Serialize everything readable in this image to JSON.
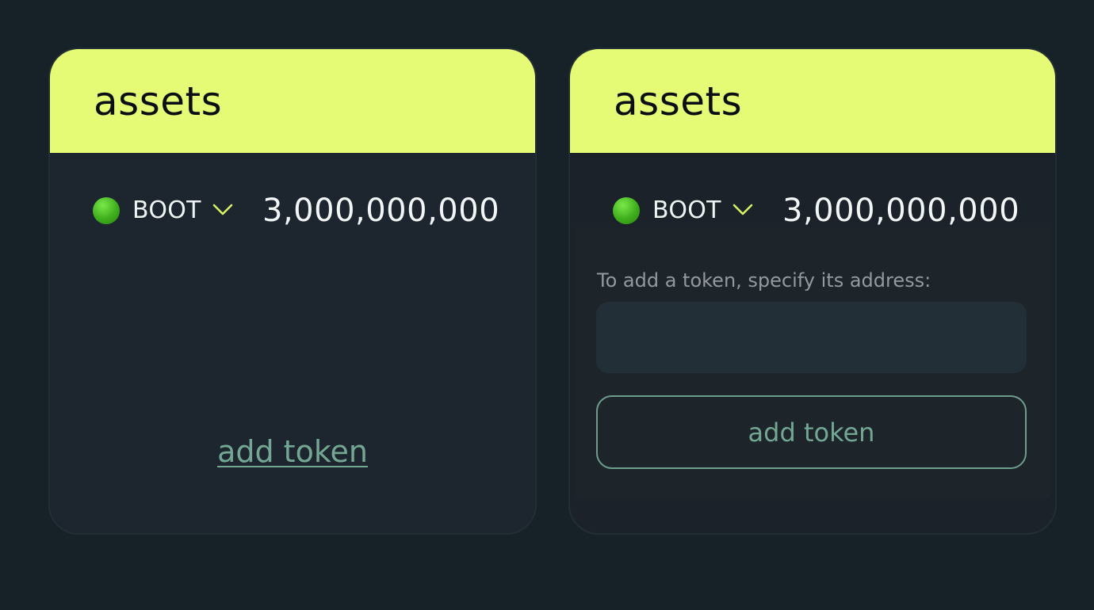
{
  "colors": {
    "background": "#172128",
    "header_accent": "#e5fa75",
    "link_green": "#73a794",
    "token_dot": "#3fae1d"
  },
  "cards": [
    {
      "title": "assets",
      "asset": {
        "icon": "green-circle-icon",
        "symbol": "BOOT",
        "amount": "3,000,000,000"
      },
      "add_token_link": "add token"
    },
    {
      "title": "assets",
      "asset": {
        "icon": "green-circle-icon",
        "symbol": "BOOT",
        "amount": "3,000,000,000"
      },
      "add_panel": {
        "hint": "To add a token, specify its address:",
        "address_value": "",
        "address_placeholder": "",
        "button_label": "add token"
      }
    }
  ]
}
